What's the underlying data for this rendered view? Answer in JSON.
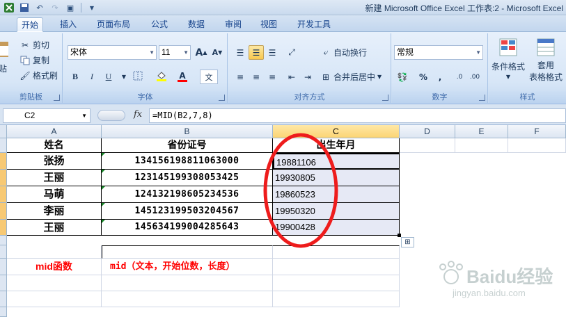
{
  "window": {
    "title": "新建 Microsoft Office Excel 工作表:2 - Microsoft Excel"
  },
  "tabs": [
    "开始",
    "插入",
    "页面布局",
    "公式",
    "数据",
    "审阅",
    "视图",
    "开发工具"
  ],
  "ribbon": {
    "clipboard": {
      "paste": "贴",
      "cut": "剪切",
      "copy": "复制",
      "format_painter": "格式刷",
      "label": "剪贴板"
    },
    "font": {
      "name": "宋体",
      "size": "11",
      "label": "字体",
      "bold": "B",
      "italic": "I",
      "underline": "U",
      "grow": "A",
      "shrink": "A",
      "phonetic": "文"
    },
    "alignment": {
      "wrap": "自动换行",
      "merge": "合并后居中",
      "label": "对齐方式"
    },
    "number": {
      "format": "常规",
      "percent": "%",
      "comma": ",",
      "label": "数字"
    },
    "styles": {
      "conditional": "条件格式",
      "table1": "套用",
      "table2": "表格格式",
      "label": "样式"
    }
  },
  "formula_bar": {
    "cell": "C2",
    "fx": "fx",
    "formula": "=MID(B2,7,8)"
  },
  "columns": [
    "A",
    "B",
    "C",
    "D",
    "E",
    "F"
  ],
  "table": {
    "headers": [
      "姓名",
      "省份证号",
      "出生年月"
    ],
    "rows": [
      {
        "name": "张扬",
        "id": "134156198811063000",
        "birth": "19881106"
      },
      {
        "name": "王丽",
        "id": "123145199308053425",
        "birth": "19930805"
      },
      {
        "name": "马萌",
        "id": "124132198605234536",
        "birth": "19860523"
      },
      {
        "name": "李丽",
        "id": "145123199503204567",
        "birth": "19950320"
      },
      {
        "name": "王丽",
        "id": "145634199004285643",
        "birth": "19900428"
      }
    ]
  },
  "notes": {
    "func_name": "mid函数",
    "func_syntax": "mid（文本，开始位数，长度）"
  },
  "watermark": {
    "brand": "Baidu经验",
    "url": "jingyan.baidu.com"
  },
  "colors": {
    "accent_red": "#ff0000",
    "selection": "#e6e9f5",
    "ribbon_blue": "#15428b"
  }
}
